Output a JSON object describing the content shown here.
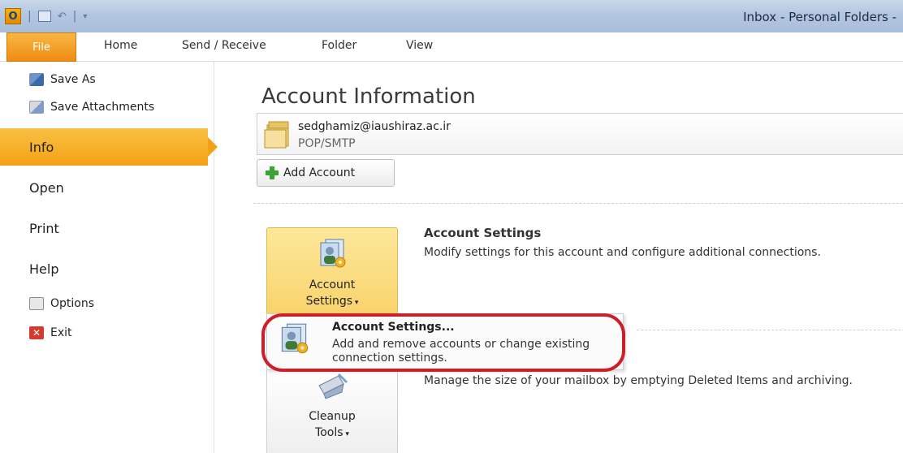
{
  "window": {
    "title": "Inbox - Personal Folders -",
    "logo_letter": "O"
  },
  "ribbon": {
    "tabs": [
      "File",
      "Home",
      "Send / Receive",
      "Folder",
      "View"
    ]
  },
  "nav": {
    "commands": [
      {
        "label": "Save As",
        "icon": "save-as-icon"
      },
      {
        "label": "Save Attachments",
        "icon": "save-attachments-icon"
      }
    ],
    "items": [
      "Info",
      "Open",
      "Print",
      "Help"
    ],
    "active": "Info",
    "footer": [
      {
        "label": "Options",
        "icon": "options-icon"
      },
      {
        "label": "Exit",
        "icon": "exit-icon"
      }
    ]
  },
  "main": {
    "title": "Account Information",
    "account": {
      "email": "sedghamiz@iaushiraz.ac.ir",
      "type": "POP/SMTP"
    },
    "add_account_label": "Add Account",
    "account_settings": {
      "button_line1": "Account",
      "button_line2": "Settings",
      "title": "Account Settings",
      "description": "Modify settings for this account and configure additional connections."
    },
    "cleanup": {
      "button_line1": "Cleanup",
      "button_line2": "Tools",
      "description": "Manage the size of your mailbox by emptying Deleted Items and archiving."
    },
    "dropdown": {
      "title": "Account Settings...",
      "description": "Add and remove accounts or change existing connection settings."
    }
  },
  "colors": {
    "file_tab": "#f08c14",
    "active_nav": "#f5a114",
    "highlight": "#cc1f2a",
    "hot_button": "#f9d36c"
  }
}
